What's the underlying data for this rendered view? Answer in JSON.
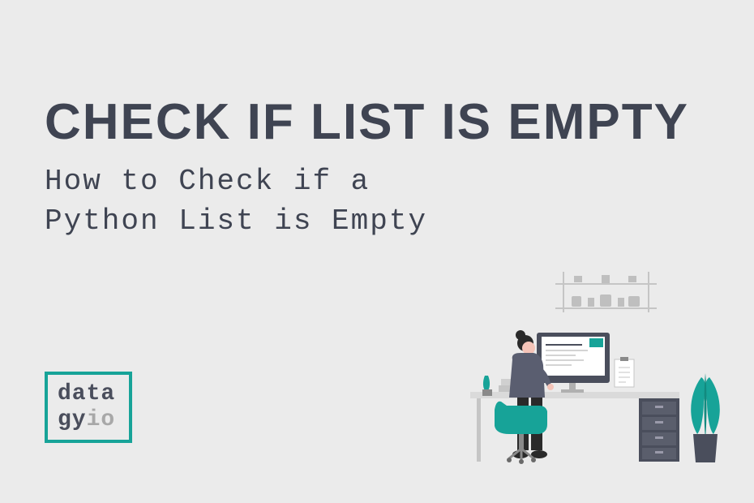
{
  "title": "CHECK IF LIST IS EMPTY",
  "subtitle_line1": "How to Check if a",
  "subtitle_line2": "Python List is Empty",
  "logo": {
    "line1": "data",
    "line2_part1": "gy",
    "line2_part2": "io"
  },
  "colors": {
    "background": "#ebebeb",
    "text_primary": "#3f4452",
    "accent": "#17a398",
    "muted": "#a8a8a8"
  }
}
